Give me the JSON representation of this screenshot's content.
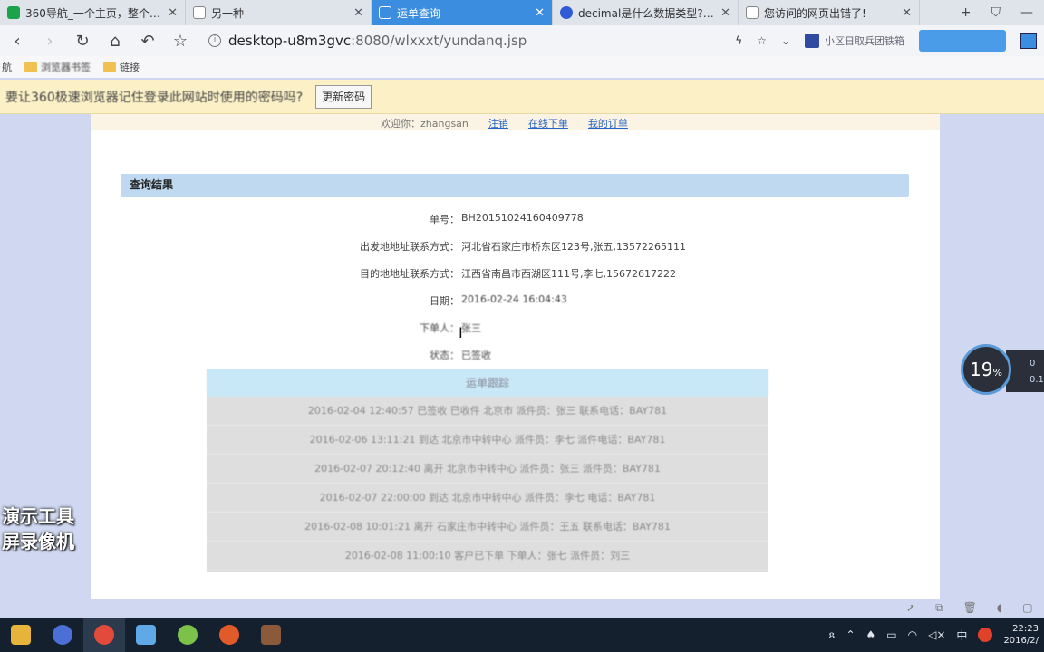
{
  "browser": {
    "tabs": [
      {
        "title": "360导航_一个主页，整个世界",
        "icon_color": "#1aa34a",
        "active": false
      },
      {
        "title": "另一种",
        "icon_color": "#ffffff",
        "active": false
      },
      {
        "title": "运单查询",
        "icon_color": "#ffffff",
        "active": true
      },
      {
        "title": "decimal是什么数据类型?_百",
        "icon_color": "#2f5bd6",
        "active": false
      },
      {
        "title": "您访问的网页出错了!",
        "icon_color": "#ffffff",
        "active": false
      }
    ],
    "new_tab": "+",
    "url_host": "desktop-u8m3gvc",
    "url_path": ":8080/wlxxxt/yundanq.jsp",
    "plugin_label": "小区日取兵团铁箱"
  },
  "bookmarks": [
    "航",
    "浏览器书签",
    "链接"
  ],
  "password_prompt": {
    "text": "要让360极速浏览器记住登录此网站时使用的密码吗?",
    "button": "更新密码"
  },
  "page": {
    "welcome_text": "欢迎你：zhangsan",
    "links": [
      "注销",
      "在线下单",
      "我的订单"
    ],
    "result_title": "查询结果",
    "fields": [
      {
        "label": "单号：",
        "value": "BH20151024160409778"
      },
      {
        "label": "出发地地址联系方式：",
        "value": "河北省石家庄市桥东区123号,张五,13572265111"
      },
      {
        "label": "目的地地址联系方式：",
        "value": "江西省南昌市西湖区111号,李七,15672617222"
      },
      {
        "label": "日期：",
        "value": "2016-02-24 16:04:43"
      },
      {
        "label": "下单人：",
        "value": "张三"
      },
      {
        "label": "状态：",
        "value": "已签收"
      }
    ],
    "log_title": "运单跟踪",
    "log_rows": [
      "2016-02-04 12:40:57 已签收 已收件 北京市 派件员：张三 联系电话：BAY781",
      "2016-02-06 13:11:21 到达 北京市中转中心 派件员：李七 派件电话：BAY781",
      "2016-02-07 20:12:40 离开 北京市中转中心 派件员：张三 派件员：BAY781",
      "2016-02-07 22:00:00 到达 北京市中转中心 派件员：李七 电话：BAY781",
      "2016-02-08 10:01:21 离开 石家庄市中转中心 派件员：王五 联系电话：BAY781",
      "2016-02-08 11:00:10 客户已下单 下单人：张七 派件员：刘三"
    ]
  },
  "watermark_text": [
    "演示工具",
    "屏录像机"
  ],
  "speed_widget": {
    "value": "19",
    "unit": "%",
    "up": "0",
    "down": "0.1"
  },
  "taskbar": {
    "apps": [
      {
        "name": "file-explorer",
        "color": "#e6b43a"
      },
      {
        "name": "eclipse",
        "color": "#4b6fd4"
      },
      {
        "name": "chrome",
        "color": "#e24a3b"
      },
      {
        "name": "app-blue",
        "color": "#5fa9e6"
      },
      {
        "name": "360-browser",
        "color": "#7cc24a"
      },
      {
        "name": "app-red",
        "color": "#e05a2a"
      },
      {
        "name": "film-app",
        "color": "#8a5a3a"
      }
    ],
    "ime": "中",
    "time": "22:23",
    "date": "2016/2/"
  }
}
